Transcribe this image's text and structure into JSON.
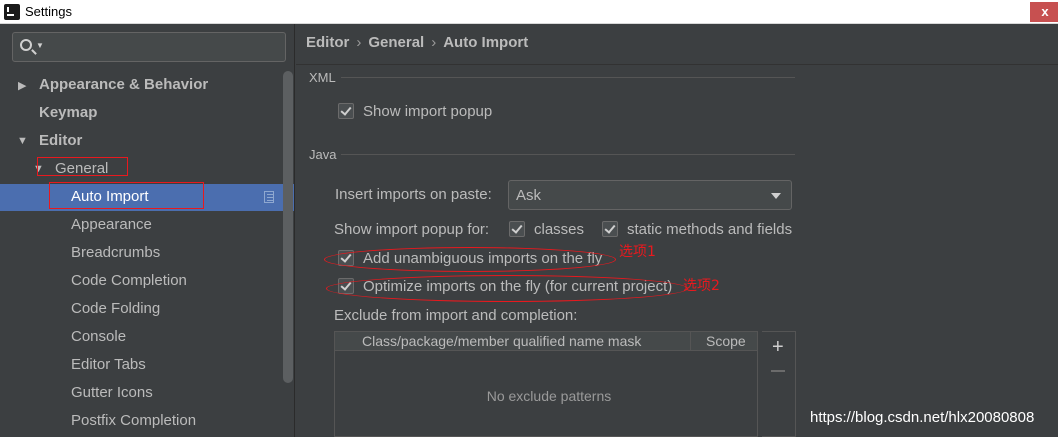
{
  "window": {
    "title": "Settings",
    "close_label": "x"
  },
  "sidebar": {
    "tree": [
      {
        "label": "Appearance & Behavior"
      },
      {
        "label": "Keymap"
      },
      {
        "label": "Editor"
      },
      {
        "label": "General"
      },
      {
        "label": "Auto Import",
        "selected": true
      },
      {
        "label": "Appearance"
      },
      {
        "label": "Breadcrumbs"
      },
      {
        "label": "Code Completion"
      },
      {
        "label": "Code Folding"
      },
      {
        "label": "Console"
      },
      {
        "label": "Editor Tabs"
      },
      {
        "label": "Gutter Icons"
      },
      {
        "label": "Postfix Completion"
      }
    ]
  },
  "breadcrumb": [
    "Editor",
    "General",
    "Auto Import"
  ],
  "xml": {
    "section_title": "XML",
    "show_import_popup": {
      "label": "Show import popup",
      "checked": true
    }
  },
  "java": {
    "section_title": "Java",
    "insert_on_paste": {
      "label": "Insert imports on paste:",
      "value": "Ask"
    },
    "show_popup_for": {
      "label": "Show import popup for:",
      "classes": {
        "label": "classes",
        "checked": true
      },
      "static": {
        "label": "static methods and fields",
        "checked": true
      }
    },
    "add_unambiguous": {
      "label": "Add unambiguous imports on the fly",
      "checked": true
    },
    "optimize": {
      "label": "Optimize imports on the fly (for current project)",
      "checked": true
    },
    "exclude": {
      "label": "Exclude from import and completion:",
      "columns": [
        "Class/package/member qualified name mask",
        "Scope"
      ],
      "empty_text": "No exclude patterns"
    }
  },
  "annotations": {
    "option1": "选项1",
    "option2": "选项2"
  },
  "watermark": "https://blog.csdn.net/hlx20080808",
  "colors": {
    "selection": "#4b6eaf",
    "annotation": "#e8191e",
    "background": "#3c3f41"
  }
}
